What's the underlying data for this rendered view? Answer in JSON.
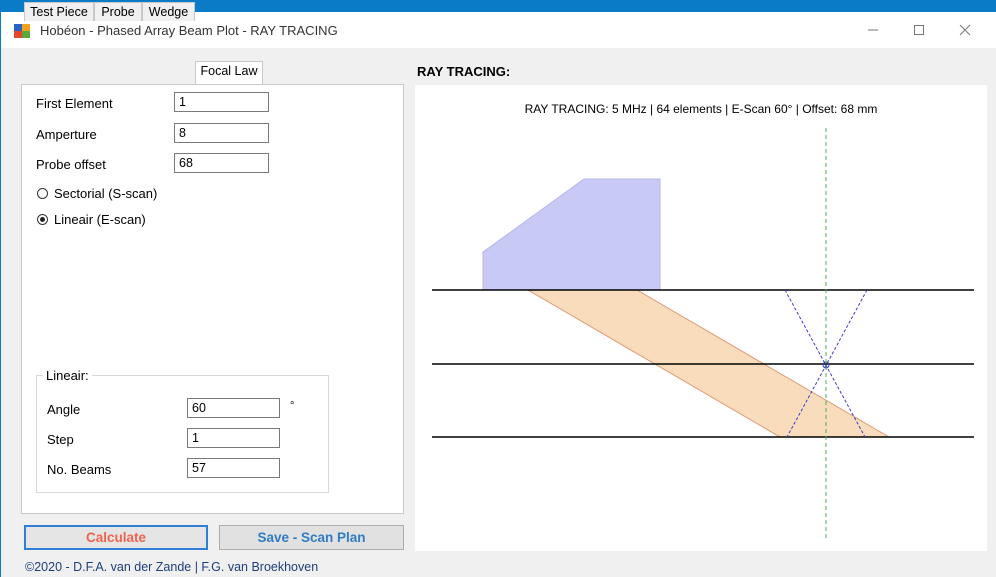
{
  "window": {
    "title": "Hobéon - Phased Array Beam Plot - RAY TRACING",
    "icon": "app-icon",
    "controls": {
      "minimize": "─",
      "maximize": "☐",
      "close": "✕"
    }
  },
  "tabs": [
    {
      "label": "Test Piece",
      "active": false
    },
    {
      "label": "Probe",
      "active": false
    },
    {
      "label": "Wedge",
      "active": false
    },
    {
      "label": "Focal Law",
      "active": true
    }
  ],
  "focal_law": {
    "first_element_label": "First Element",
    "first_element_value": "1",
    "aperture_label": "Amperture",
    "aperture_value": "8",
    "probe_offset_label": "Probe offset",
    "probe_offset_value": "68",
    "scan_options": [
      {
        "label": "Sectorial (S-scan)",
        "selected": false
      },
      {
        "label": "Lineair (E-scan)",
        "selected": true
      }
    ],
    "lineair_group": {
      "title": "Lineair:",
      "angle_label": "Angle",
      "angle_value": "60",
      "angle_unit": "°",
      "step_label": "Step",
      "step_value": "1",
      "beams_label": "No. Beams",
      "beams_value": "57"
    }
  },
  "buttons": {
    "calculate": "Calculate",
    "save": "Save - Scan Plan"
  },
  "footer": "©2020 - D.F.A. van der Zande | F.G. van Broekhoven",
  "ray_tracing": {
    "heading": "RAY TRACING:",
    "plot_title": "RAY TRACING: 5 MHz | 64 elements | E-Scan 60° | Offset: 68 mm"
  },
  "colors": {
    "wedge": "#c9c9f6",
    "beam_fill": "#f9dcbb",
    "beam_edge": "#e09a78",
    "focus_rays": "#3a3ad0",
    "center_line": "#4caf50",
    "calculate_text": "#f0634f",
    "save_text": "#2f7cc4"
  }
}
